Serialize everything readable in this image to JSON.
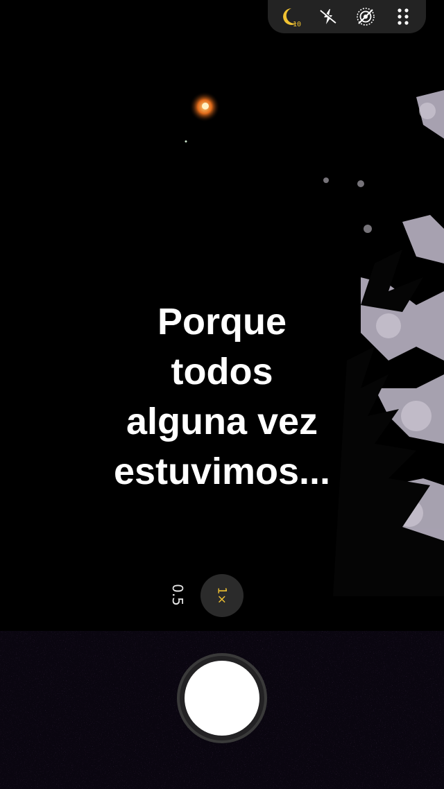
{
  "toolbar": {
    "night_mode_value": "10",
    "accent_color": "#f1c232",
    "icons": [
      "night-mode-icon",
      "flash-off-icon",
      "live-off-icon",
      "more-grid-icon"
    ]
  },
  "caption": {
    "lines": [
      "Porque",
      "todos",
      "alguna vez",
      "estuvimos..."
    ]
  },
  "zoom": {
    "wide_label": "0.5",
    "main_label": "1×",
    "selected": "1×"
  },
  "shutter": {
    "icon": "shutter-button"
  }
}
